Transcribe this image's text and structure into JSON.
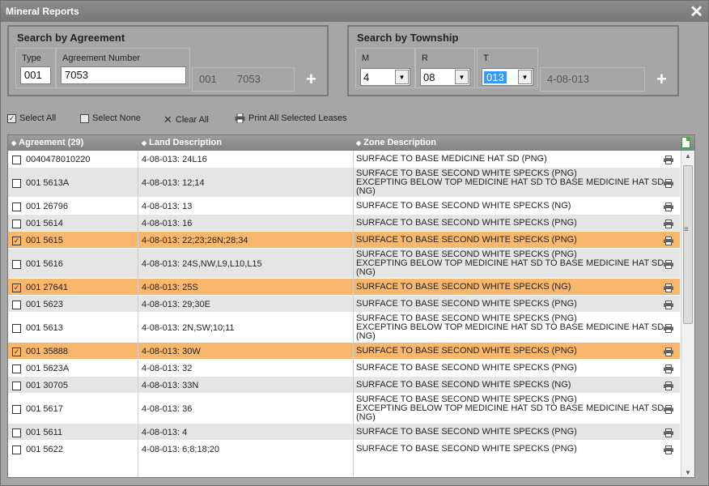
{
  "window": {
    "title": "Mineral Reports",
    "close_glyph": "✕"
  },
  "search_agreement": {
    "label": "Search by Agreement",
    "type_label": "Type",
    "type_value": "001",
    "number_label": "Agreement Number",
    "number_value": "7053",
    "readout_type": "001",
    "readout_number": "7053",
    "add_glyph": "+"
  },
  "search_township": {
    "label": "Search by Township",
    "m_label": "M",
    "m_value": "4",
    "r_label": "R",
    "r_value": "08",
    "t_label": "T",
    "t_value": "013",
    "readout": "4-08-013",
    "add_glyph": "+"
  },
  "toolbar": {
    "select_all": "Select All",
    "select_none": "Select None",
    "clear_all": "Clear All",
    "print_all": "Print All Selected Leases"
  },
  "grid": {
    "columns": [
      "Agreement (29)",
      "Land Description",
      "Zone Description"
    ],
    "rows": [
      {
        "agreement": "0040478010220",
        "land": "4-08-013: 24L16",
        "zone": [
          "SURFACE TO BASE MEDICINE HAT SD (PNG)"
        ],
        "checked": false
      },
      {
        "agreement": "001 5613A",
        "land": "4-08-013: 12;14",
        "zone": [
          "SURFACE TO BASE SECOND WHITE SPECKS (PNG)",
          "EXCEPTING BELOW TOP MEDICINE HAT SD TO BASE MEDICINE HAT SD",
          "(NG)"
        ],
        "checked": false
      },
      {
        "agreement": "001 26796",
        "land": "4-08-013: 13",
        "zone": [
          "SURFACE TO BASE SECOND WHITE SPECKS (NG)"
        ],
        "checked": false
      },
      {
        "agreement": "001 5614",
        "land": "4-08-013: 16",
        "zone": [
          "SURFACE TO BASE SECOND WHITE SPECKS (PNG)"
        ],
        "checked": false
      },
      {
        "agreement": "001 5615",
        "land": "4-08-013: 22;23;26N;28;34",
        "zone": [
          "SURFACE TO BASE SECOND WHITE SPECKS (PNG)"
        ],
        "checked": true
      },
      {
        "agreement": "001 5616",
        "land": "4-08-013: 24S,NW,L9,L10,L15",
        "zone": [
          "SURFACE TO BASE SECOND WHITE SPECKS (PNG)",
          "EXCEPTING BELOW TOP MEDICINE HAT SD TO BASE MEDICINE HAT SD",
          "(NG)"
        ],
        "checked": false
      },
      {
        "agreement": "001 27641",
        "land": "4-08-013: 25S",
        "zone": [
          "SURFACE TO BASE SECOND WHITE SPECKS (NG)"
        ],
        "checked": true
      },
      {
        "agreement": "001 5623",
        "land": "4-08-013: 29;30E",
        "zone": [
          "SURFACE TO BASE SECOND WHITE SPECKS (PNG)"
        ],
        "checked": false
      },
      {
        "agreement": "001 5613",
        "land": "4-08-013: 2N,SW;10;11",
        "zone": [
          "SURFACE TO BASE SECOND WHITE SPECKS (PNG)",
          "EXCEPTING BELOW TOP MEDICINE HAT SD TO BASE MEDICINE HAT SD",
          "(NG)"
        ],
        "checked": false
      },
      {
        "agreement": "001 35888",
        "land": "4-08-013: 30W",
        "zone": [
          "SURFACE TO BASE SECOND WHITE SPECKS (PNG)"
        ],
        "checked": true
      },
      {
        "agreement": "001 5623A",
        "land": "4-08-013: 32",
        "zone": [
          "SURFACE TO BASE SECOND WHITE SPECKS (PNG)"
        ],
        "checked": false
      },
      {
        "agreement": "001 30705",
        "land": "4-08-013: 33N",
        "zone": [
          "SURFACE TO BASE SECOND WHITE SPECKS (NG)"
        ],
        "checked": false
      },
      {
        "agreement": "001 5617",
        "land": "4-08-013: 36",
        "zone": [
          "SURFACE TO BASE SECOND WHITE SPECKS (PNG)",
          "EXCEPTING BELOW TOP MEDICINE HAT SD TO BASE MEDICINE HAT SD",
          "(NG)"
        ],
        "checked": false
      },
      {
        "agreement": "001 5611",
        "land": "4-08-013: 4",
        "zone": [
          "SURFACE TO BASE SECOND WHITE SPECKS (PNG)"
        ],
        "checked": false
      },
      {
        "agreement": "001 5622",
        "land": "4-08-013: 6;8;18;20",
        "zone": [
          "SURFACE TO BASE SECOND WHITE SPECKS (PNG)"
        ],
        "checked": false
      }
    ]
  },
  "colors": {
    "checked_row": "#f8b76d",
    "alt_row": "#e5e5e5",
    "panel": "#a6a6a6"
  }
}
